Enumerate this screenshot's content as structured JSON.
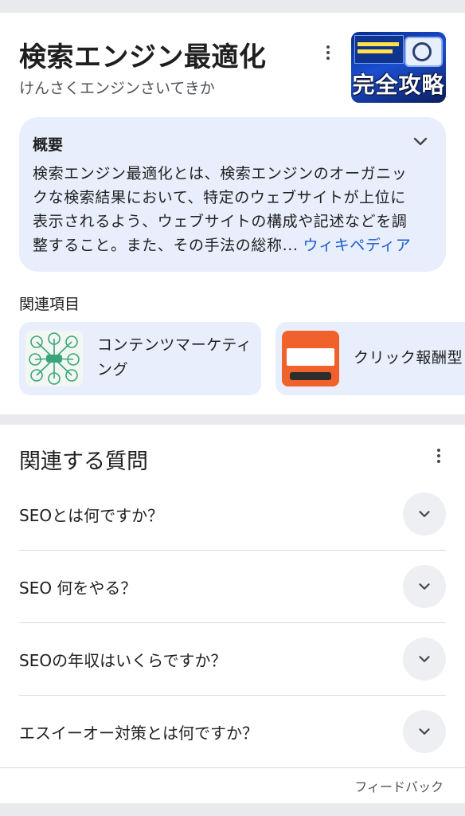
{
  "knowledge_panel": {
    "title": "検索エンジン最適化",
    "reading": "けんさくエンジンさいてきか",
    "thumbnail_text": "完全攻略",
    "overview": {
      "heading": "概要",
      "lines": [
        "検索エンジン最適化とは、検索エンジンのオーガニッ",
        "クな検索結果において、特定のウェブサイトが上位に",
        "表示されるよう、ウェブサイトの構成や記述などを調",
        "整すること。また、その手法の総称..."
      ],
      "source_link": "ウィキペディア"
    },
    "related_heading": "関連項目",
    "related_items": [
      {
        "label": "コンテンツマーケティング"
      },
      {
        "label": "クリック報酬型"
      }
    ]
  },
  "people_also_ask": {
    "title": "関連する質問",
    "questions": [
      "SEOとは何ですか？",
      "SEO 何をやる？",
      "SEOの年収はいくらですか？",
      "エスイーオー対策とは何ですか？"
    ],
    "feedback_label": "フィードバック"
  },
  "colors": {
    "page_background": "#e9eaee",
    "card_background": "#ffffff",
    "chip_background": "#e8eefc",
    "link": "#1a5ccf",
    "expand_button": "#eeeff2"
  }
}
